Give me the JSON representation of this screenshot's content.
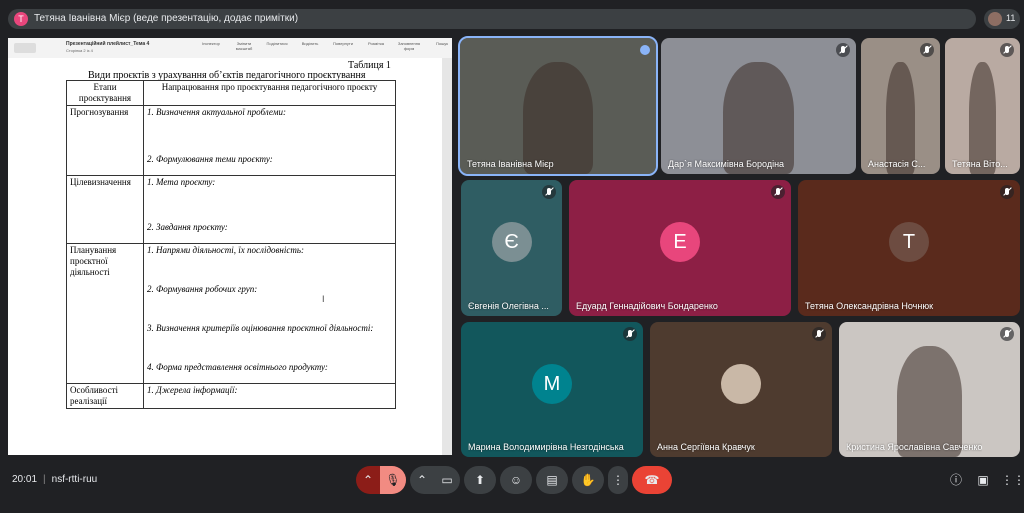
{
  "banner": {
    "avatar_letter": "T",
    "text": "Тетяна Іванівна Мієр (веде презентацію, додає примітки)"
  },
  "participants_count": "11",
  "presentation": {
    "doc_title": "Презентаційний плейлист_Тема 4",
    "page_info": "Сторінка 2 із 4",
    "toolbar": [
      "Інспектор",
      "Змінити масштаб",
      "Поділитися",
      "Виділить",
      "Повернути",
      "Розмітка",
      "Заповнення форм",
      "Пошук"
    ],
    "table_label": "Таблиця 1",
    "caption": "Види проєктів з урахування об’єктів педагогічного проєктування",
    "headers": [
      "Етапи проєктування",
      "Напрацювання про проєктування педагогічного проєкту"
    ],
    "rows": [
      {
        "stage": "Прогнозування",
        "items": [
          "1. Визначення актуальної проблеми:",
          "2. Формулювання теми проєкту:"
        ]
      },
      {
        "stage": "Цілевизначення",
        "items": [
          "1. Мета проєкту:",
          "2. Завдання проєкту:"
        ]
      },
      {
        "stage": "Планування проєктної діяльності",
        "items": [
          "1. Напрями діяльності, їх послідовність:",
          "2. Формування робочих груп:",
          "3. Визначення критеріїв оцінювання проєктної діяльності:",
          "4. Форма представлення освітнього продукту:"
        ]
      },
      {
        "stage": "Особливості реалізації",
        "items": [
          "1. Джерела інформації:"
        ]
      }
    ]
  },
  "participants": [
    {
      "name": "Тетяна Іванівна Мієр",
      "kind": "video",
      "bg": "#5a5c56"
    },
    {
      "name": "Дар`я Максимівна Бородіна",
      "kind": "video",
      "bg": "#8d8f96"
    },
    {
      "name": "Анастасія С...",
      "kind": "video",
      "bg": "#9a8f86"
    },
    {
      "name": "Тетяна Віто...",
      "kind": "video",
      "bg": "#b9aaa2"
    },
    {
      "name": "Євгенія Олегівна ...",
      "kind": "letter",
      "letter": "Є",
      "bg": "#2f5d63",
      "circle": "#7b8f93"
    },
    {
      "name": "Едуард Геннадійович Бондаренко",
      "kind": "letter",
      "letter": "E",
      "bg": "#8d1f45",
      "circle": "#e8467c"
    },
    {
      "name": "Тетяна Олександрівна Ночнюк",
      "kind": "letter",
      "letter": "T",
      "bg": "#5a2a1c",
      "circle": "#6d4c41"
    },
    {
      "name": "Марина Володимирівна Незгодінська",
      "kind": "letter",
      "letter": "M",
      "bg": "#12575c",
      "circle": "#00838f"
    },
    {
      "name": "Анна Сергіївна Кравчук",
      "kind": "photo",
      "bg": "#4e3b2f"
    },
    {
      "name": "Кристина Ярославівна Савченко",
      "kind": "video",
      "bg": "#cbc6c2"
    }
  ],
  "meeting": {
    "time": "20:01",
    "code": "nsf-rtti-ruu"
  },
  "colors": {
    "accent": "#8ab4f8",
    "end_call": "#ea4335",
    "muted": "#8c1d18"
  },
  "icons": [
    "mic-off-icon",
    "camera-icon",
    "present-icon",
    "emoji-icon",
    "captions-icon",
    "raise-hand-icon",
    "more-icon",
    "end-call-icon",
    "info-icon",
    "chat-icon",
    "apps-icon"
  ]
}
